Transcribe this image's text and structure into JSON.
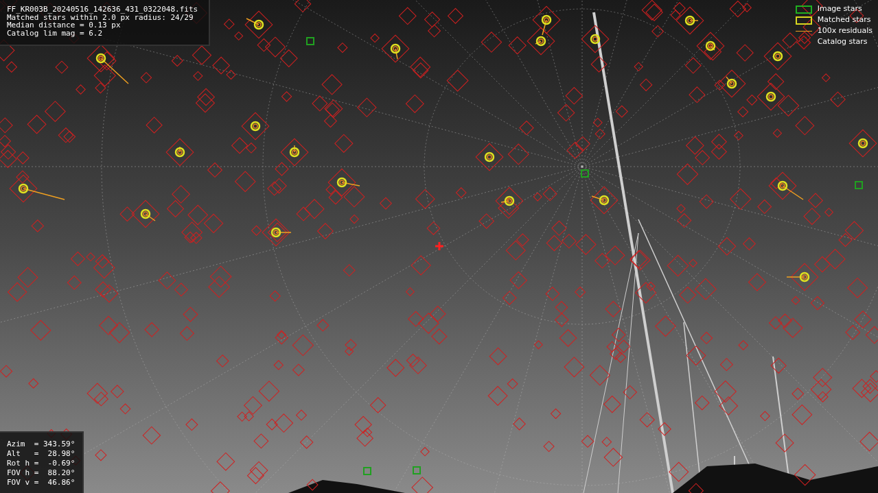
{
  "info_panel": {
    "lines": [
      "FF_KR003B_20240516_142636_431_0322048.fits",
      "Matched stars within 2.0 px radius: 24/29",
      "Median distance = 0.13 px",
      "Catalog lim mag = 6.2"
    ]
  },
  "legend": [
    {
      "kind": "image",
      "label": "Image stars"
    },
    {
      "kind": "matched",
      "label": "Matched stars"
    },
    {
      "kind": "residual",
      "label": "100x residuals"
    },
    {
      "kind": "catalog",
      "label": "Catalog stars"
    }
  ],
  "pointing_panel": {
    "lines": [
      "Azim  = 343.59°",
      "Alt   =  28.98°",
      "Rot h =  -0.69°",
      "FOV h =  88.20°",
      "FOV v =  46.86°"
    ]
  }
}
